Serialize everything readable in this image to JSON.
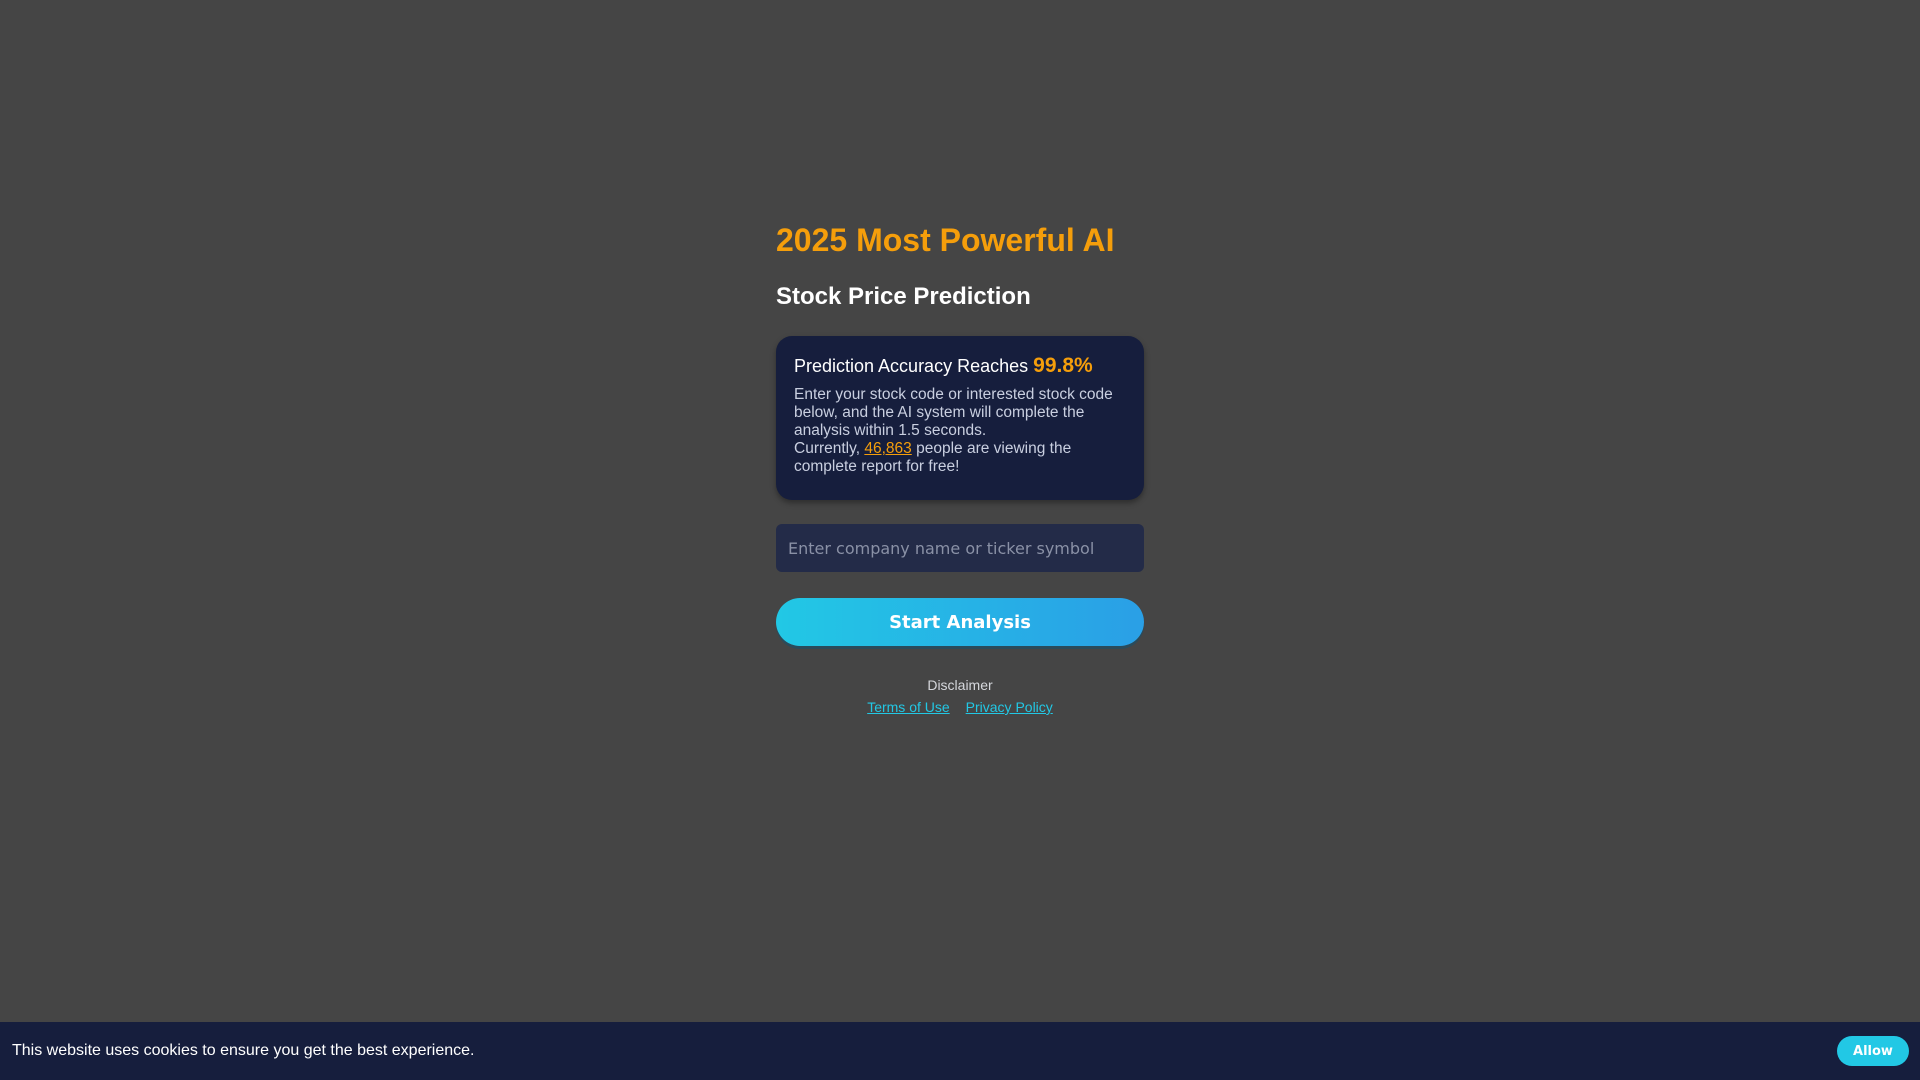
{
  "hero": {
    "headline": "2025 Most Powerful AI",
    "subheadline": "Stock Price Prediction"
  },
  "card": {
    "title_prefix": "Prediction Accuracy Reaches",
    "accuracy": "99.8%",
    "description": "Enter your stock code or interested stock code below, and the AI system will complete the analysis within 1.5 seconds.",
    "viewers_prefix": "Currently,",
    "viewer_count": "46,863",
    "viewers_suffix": "people are viewing the complete report for free!"
  },
  "search": {
    "placeholder": "Enter company name or ticker symbol",
    "value": ""
  },
  "actions": {
    "start_label": "Start Analysis"
  },
  "footer": {
    "disclaimer": "Disclaimer",
    "terms_label": "Terms of Use",
    "privacy_label": "Privacy Policy"
  },
  "cookie": {
    "message": "This website uses cookies to ensure you get the best experience.",
    "allow_label": "Allow"
  },
  "colors": {
    "background": "#454545",
    "accent_orange": "#f59e0b",
    "card_navy": "#161e3d",
    "button_cyan": "#22c8e5"
  }
}
